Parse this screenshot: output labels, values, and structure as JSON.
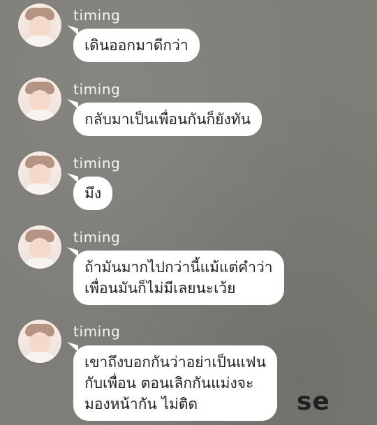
{
  "messages": [
    {
      "sender": "timing",
      "text": "เดินออกมาดีกว่า"
    },
    {
      "sender": "timing",
      "text": "กลับมาเป็นเพื่อนกันก็ยังทัน"
    },
    {
      "sender": "timing",
      "text": "มึง"
    },
    {
      "sender": "timing",
      "text": "ถ้ามันมากไปกว่านี้แม้แต่คำว่า\nเพื่อนมันก็ไม่มีเลยนะเว้ย"
    },
    {
      "sender": "timing",
      "text": "เขาถึงบอกกันว่าอย่าเป็นแฟน\nกับเพื่อน ตอนเลิกกันแม่งจะ\nมองหน้ากัน ไม่ติด"
    }
  ],
  "background_text": "se"
}
